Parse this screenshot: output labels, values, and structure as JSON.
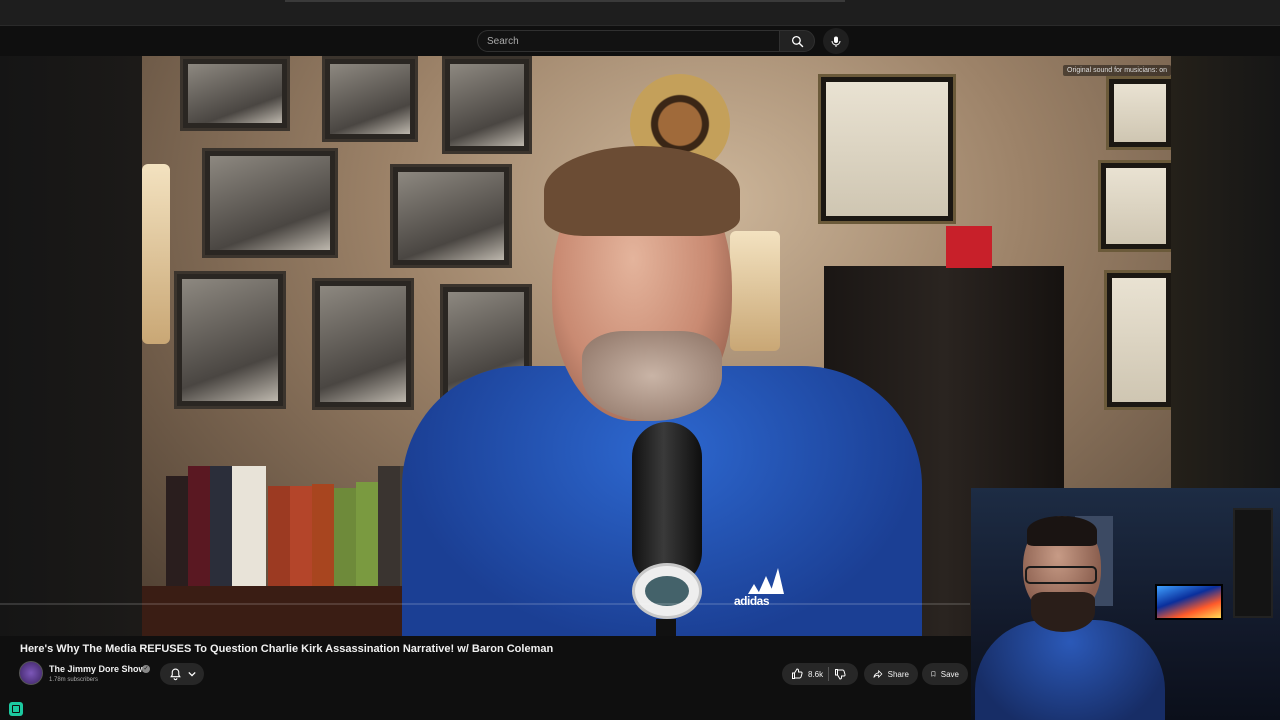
{
  "search": {
    "placeholder": "Search"
  },
  "video": {
    "overlay_badge": "Original sound for musicians: on",
    "brand_text": "adidas"
  },
  "info": {
    "title": "Here's Why The Media REFUSES To Question Charlie Kirk Assassination Narrative! w/ Baron Coleman",
    "channel_name": "The Jimmy Dore Show",
    "subscribers": "1.78m subscribers",
    "like_count": "8.6k",
    "share_label": "Share",
    "save_label": "Save"
  },
  "icons": {
    "search": "search-icon",
    "mic": "microphone-icon",
    "bell": "bell-icon",
    "like": "thumbs-up-icon",
    "dislike": "thumbs-down-icon",
    "share": "share-icon",
    "save": "bookmark-icon"
  },
  "colors": {
    "accent": "#272727",
    "tray_icon": "#1cc9a0"
  }
}
